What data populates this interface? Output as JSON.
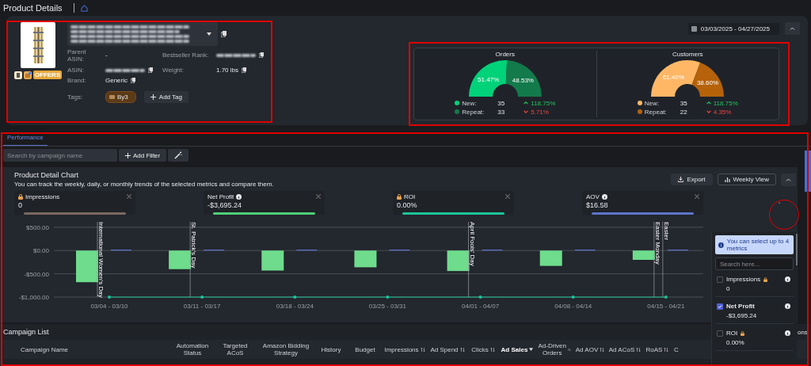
{
  "header": {
    "title": "Product Details"
  },
  "product": {
    "badge": "OFFERS",
    "fields": [
      {
        "label": "Parent ASIN:",
        "value": "-"
      },
      {
        "label": "Bestseller Rank:",
        "blurred": true
      },
      {
        "label": "ASIN:",
        "blurred": true
      },
      {
        "label": "Weight:",
        "value": "1.70 lbs"
      },
      {
        "label": "Brand:",
        "value": "Generic"
      }
    ],
    "tags_label": "Tags:",
    "tags": [
      {
        "label": "By3",
        "color": "#5b3a17"
      }
    ],
    "add_tag": "Add Tag"
  },
  "date_range": "03/03/2025 - 04/27/2025",
  "breakdown": [
    {
      "title": "Orders",
      "chart_data": {
        "type": "donut",
        "values": [
          51.47,
          48.53
        ],
        "value_labels": [
          "51.47%",
          "48.53%"
        ]
      },
      "rows": [
        {
          "label": "New:",
          "count": "35",
          "change": "118.75%",
          "increase": true,
          "color": "#00d27a"
        },
        {
          "label": "Repeat:",
          "count": "33",
          "change": "5.71%",
          "increase": false,
          "color": "#137a4b"
        }
      ]
    },
    {
      "title": "Customers",
      "chart_data": {
        "type": "donut",
        "values": [
          61.4,
          38.6
        ],
        "value_labels": [
          "61.40%",
          "38.60%"
        ]
      },
      "rows": [
        {
          "label": "New:",
          "count": "35",
          "change": "118.75%",
          "increase": true,
          "color": "#ffb766"
        },
        {
          "label": "Repeat:",
          "count": "22",
          "change": "4.35%",
          "increase": false,
          "color": "#b5620b"
        }
      ]
    }
  ],
  "tabs": [
    {
      "label": "Performance",
      "selected": true
    }
  ],
  "search": {
    "placeholder": "Search by campaign name"
  },
  "add_filter": "Add Filter",
  "chart_panel": {
    "title": "Product Detail Chart",
    "subtitle": "You can track the weekly, daily, or monthly trends of the selected metrics and compare them.",
    "buttons": [
      "Export",
      "Weekly View"
    ],
    "metrics": [
      {
        "label": "Impressions",
        "value": "0",
        "locked": true,
        "color": "#7b6a5e"
      },
      {
        "label": "Net Profit",
        "value": "-$3,695.24",
        "locked": false,
        "color": "#4fcf78"
      },
      {
        "label": "ROI",
        "value": "0.00%",
        "locked": true,
        "color": "#1cc498"
      },
      {
        "label": "AOV",
        "value": "$16.58",
        "locked": false,
        "color": "#5b74c9"
      }
    ],
    "chart_data": {
      "type": "bar",
      "grid": true,
      "categories": [
        "03/04 - 03/10",
        "03/11 - 03/17",
        "03/18 - 03/24",
        "03/25 - 03/31",
        "04/01 - 04/07",
        "04/08 - 04/14",
        "04/15 - 04/21"
      ],
      "yticks": [
        {
          "value": 500,
          "label": "$500.00"
        },
        {
          "value": 0,
          "label": "$0.00"
        },
        {
          "value": -500,
          "label": "-$500.00"
        },
        {
          "value": -1000,
          "label": "-$1,000.00"
        }
      ],
      "ylim": [
        -1000,
        600
      ],
      "series": [
        {
          "color": "#6edc8c",
          "values": [
            -680,
            -400,
            -430,
            -360,
            -440,
            -330,
            -200
          ]
        },
        {
          "color": "#5b74c9",
          "values": [
            20,
            20,
            20,
            20,
            20,
            20,
            20
          ]
        },
        {
          "color": "#1cc498",
          "type": "line",
          "values": [
            -1000,
            -1000,
            -1000,
            -1000,
            -1000,
            -1000,
            -1000
          ]
        }
      ],
      "annotations": [
        "International Women's Day",
        "St. Patrick's Day",
        "April Fools' Day",
        "Easter Monday",
        "Easter"
      ]
    }
  },
  "metric_menu": {
    "info": "You can select up to 4 metrics",
    "placeholder": "Search here...",
    "items": [
      {
        "label": "Impressions",
        "value": "0",
        "checked": false,
        "locked": true
      },
      {
        "label": "Net Profit",
        "value": "-$3,695.24",
        "checked": true,
        "locked": false
      },
      {
        "label": "ROI",
        "value": "0.00%",
        "checked": false,
        "locked": true
      }
    ]
  },
  "campaign_list": {
    "title": "Campaign List",
    "columns_button": "ons",
    "columns": [
      {
        "label": "Campaign Name",
        "sortable": false,
        "sorted": false
      },
      {
        "label": "Automation Status",
        "sortable": false,
        "sorted": false
      },
      {
        "label": "Targeted ACoS",
        "sortable": false,
        "sorted": false
      },
      {
        "label": "Amazon Bidding Strategy",
        "sortable": false,
        "sorted": false
      },
      {
        "label": "History",
        "sortable": false,
        "sorted": false
      },
      {
        "label": "Budget",
        "sortable": false,
        "sorted": false
      },
      {
        "label": "Impressions",
        "sortable": true,
        "sorted": false
      },
      {
        "label": "Ad Spend",
        "sortable": true,
        "sorted": false
      },
      {
        "label": "Clicks",
        "sortable": true,
        "sorted": false
      },
      {
        "label": "Ad Sales",
        "sortable": true,
        "sorted": true
      },
      {
        "label": "Ad-Driven Orders",
        "sortable": true,
        "sorted": false
      },
      {
        "label": "Ad AOV",
        "sortable": true,
        "sorted": false
      },
      {
        "label": "Ad ACoS",
        "sortable": true,
        "sorted": false
      },
      {
        "label": "RoAS",
        "sortable": true,
        "sorted": false
      },
      {
        "label": "C",
        "sortable": false,
        "sorted": false
      }
    ]
  }
}
